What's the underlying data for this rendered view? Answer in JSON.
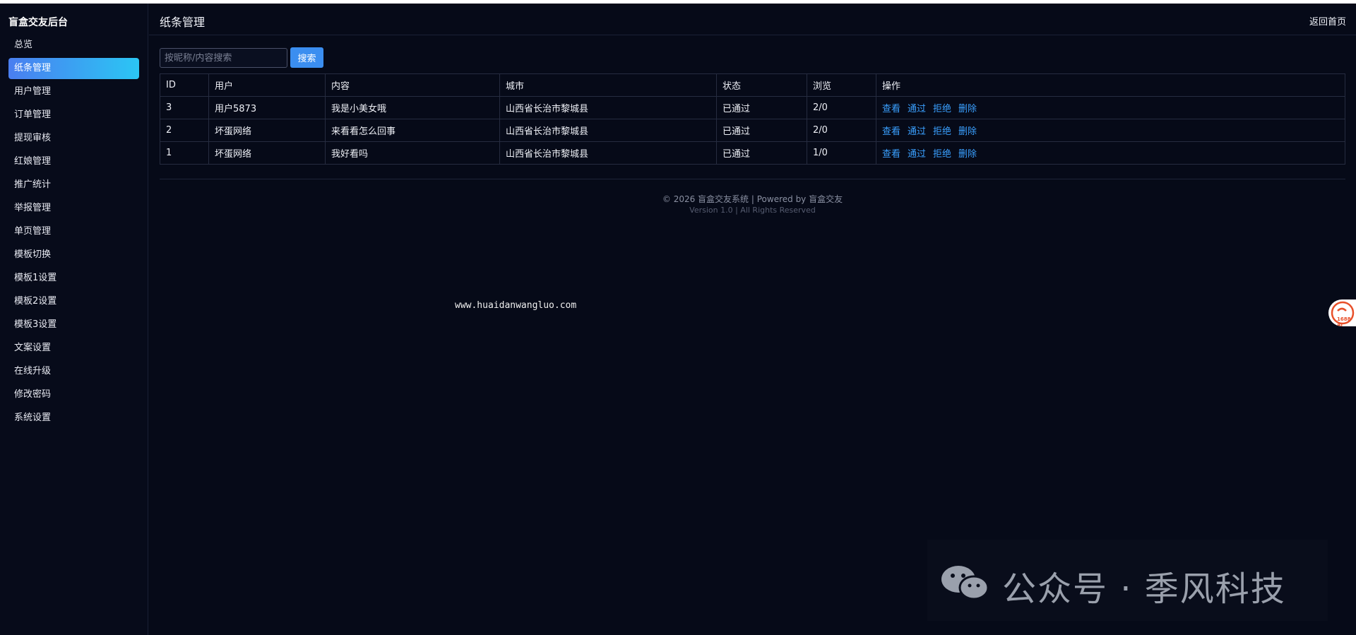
{
  "sidebar": {
    "brand": "盲盒交友后台",
    "items": [
      {
        "label": "总览",
        "active": false
      },
      {
        "label": "纸条管理",
        "active": true
      },
      {
        "label": "用户管理",
        "active": false
      },
      {
        "label": "订单管理",
        "active": false
      },
      {
        "label": "提现审核",
        "active": false
      },
      {
        "label": "红娘管理",
        "active": false
      },
      {
        "label": "推广统计",
        "active": false
      },
      {
        "label": "举报管理",
        "active": false
      },
      {
        "label": "单页管理",
        "active": false
      },
      {
        "label": "模板切换",
        "active": false
      },
      {
        "label": "模板1设置",
        "active": false
      },
      {
        "label": "模板2设置",
        "active": false
      },
      {
        "label": "模板3设置",
        "active": false
      },
      {
        "label": "文案设置",
        "active": false
      },
      {
        "label": "在线升级",
        "active": false
      },
      {
        "label": "修改密码",
        "active": false
      },
      {
        "label": "系统设置",
        "active": false
      }
    ]
  },
  "header": {
    "title": "纸条管理",
    "back_home": "返回首页"
  },
  "search": {
    "placeholder": "按昵称/内容搜索",
    "value": "",
    "button_label": "搜索"
  },
  "table": {
    "columns": [
      "ID",
      "用户",
      "内容",
      "城市",
      "状态",
      "浏览",
      "操作"
    ],
    "rows": [
      {
        "id": "3",
        "user": "用户5873",
        "content": "我是小美女哦",
        "city": "山西省长治市黎城县",
        "status": "已通过",
        "views": "2/0"
      },
      {
        "id": "2",
        "user": "坏蛋网络",
        "content": "来看看怎么回事",
        "city": "山西省长治市黎城县",
        "status": "已通过",
        "views": "2/0"
      },
      {
        "id": "1",
        "user": "坏蛋网络",
        "content": "我好看吗",
        "city": "山西省长治市黎城县",
        "status": "已通过",
        "views": "1/0"
      }
    ],
    "actions": [
      "查看",
      "通过",
      "拒绝",
      "删除"
    ]
  },
  "footer": {
    "line1": "© 2026 盲盒交友系统 | Powered by 盲盒交友",
    "line2": "Version 1.0 | All Rights Reserved"
  },
  "overlay": {
    "url_watermark": "www.huaidanwangluo.com",
    "badge_text": "1688 AI",
    "wechat_watermark": "公众号 · 季风科技"
  },
  "colors": {
    "background": "#060a18",
    "active_gradient_start": "#4a7ef0",
    "active_gradient_end": "#2bc6f4",
    "link": "#3aa0ff",
    "button": "#3b8ef0"
  }
}
